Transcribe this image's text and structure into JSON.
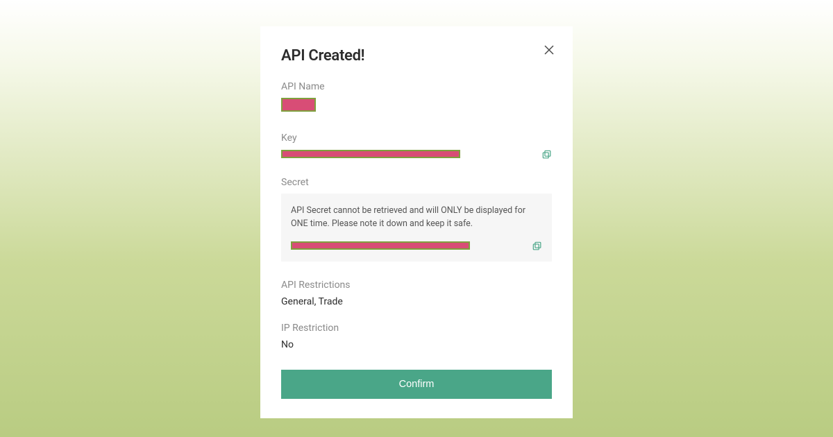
{
  "modal": {
    "title": "API Created!",
    "apiName": {
      "label": "API Name"
    },
    "key": {
      "label": "Key"
    },
    "secret": {
      "label": "Secret",
      "warning": "API Secret cannot be retrieved and will ONLY be displayed for ONE time. Please note it down and keep it safe."
    },
    "restrictions": {
      "label": "API Restrictions",
      "value": "General, Trade"
    },
    "ip": {
      "label": "IP Restriction",
      "value": "No"
    },
    "confirm": "Confirm"
  }
}
